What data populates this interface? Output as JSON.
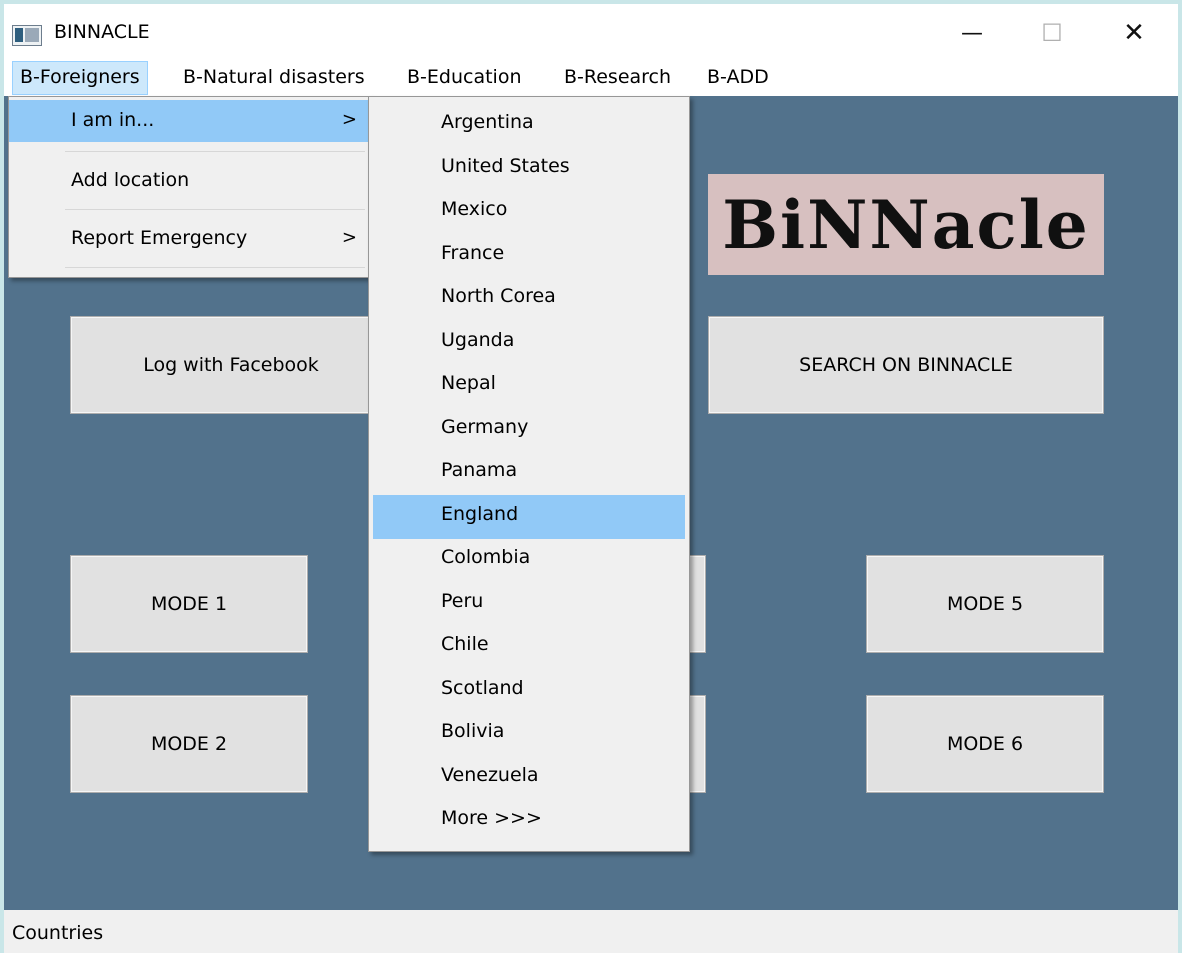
{
  "window": {
    "title": "BINNACLE",
    "minimize": "—",
    "maximize": "☐",
    "close": "✕"
  },
  "menubar": [
    {
      "label": "B-Foreigners"
    },
    {
      "label": "B-Natural disasters"
    },
    {
      "label": "B-Education"
    },
    {
      "label": "B-Research"
    },
    {
      "label": "B-ADD"
    }
  ],
  "foreigners_menu": {
    "items": [
      {
        "label": "I am in...",
        "arrow": ">"
      },
      {
        "label": "Add location",
        "arrow": ""
      },
      {
        "label": "Report Emergency",
        "arrow": ">"
      }
    ]
  },
  "countries_menu": {
    "items": [
      "Argentina",
      "United States",
      "Mexico",
      "France",
      "North Corea",
      "Uganda",
      "Nepal",
      "Germany",
      "Panama",
      "England",
      "Colombia",
      "Peru",
      "Chile",
      "Scotland",
      "Bolivia",
      "Venezuela",
      "More >>>"
    ],
    "highlighted": "England"
  },
  "logo": {
    "text": "BiNNacle"
  },
  "buttons": {
    "facebook": "Log with Facebook",
    "search": "SEARCH ON BINNACLE",
    "mode1": "MODE 1",
    "mode2": "MODE 2",
    "mode5": "MODE 5",
    "mode6": "MODE 6"
  },
  "status": {
    "text": "Countries"
  },
  "colors": {
    "client_bg": "#52728c",
    "highlight": "#91c9f7",
    "logo_bg": "#d7c0c0"
  },
  "icons": {
    "app": "app-window-icon",
    "submenu": "chevron-right-icon"
  }
}
